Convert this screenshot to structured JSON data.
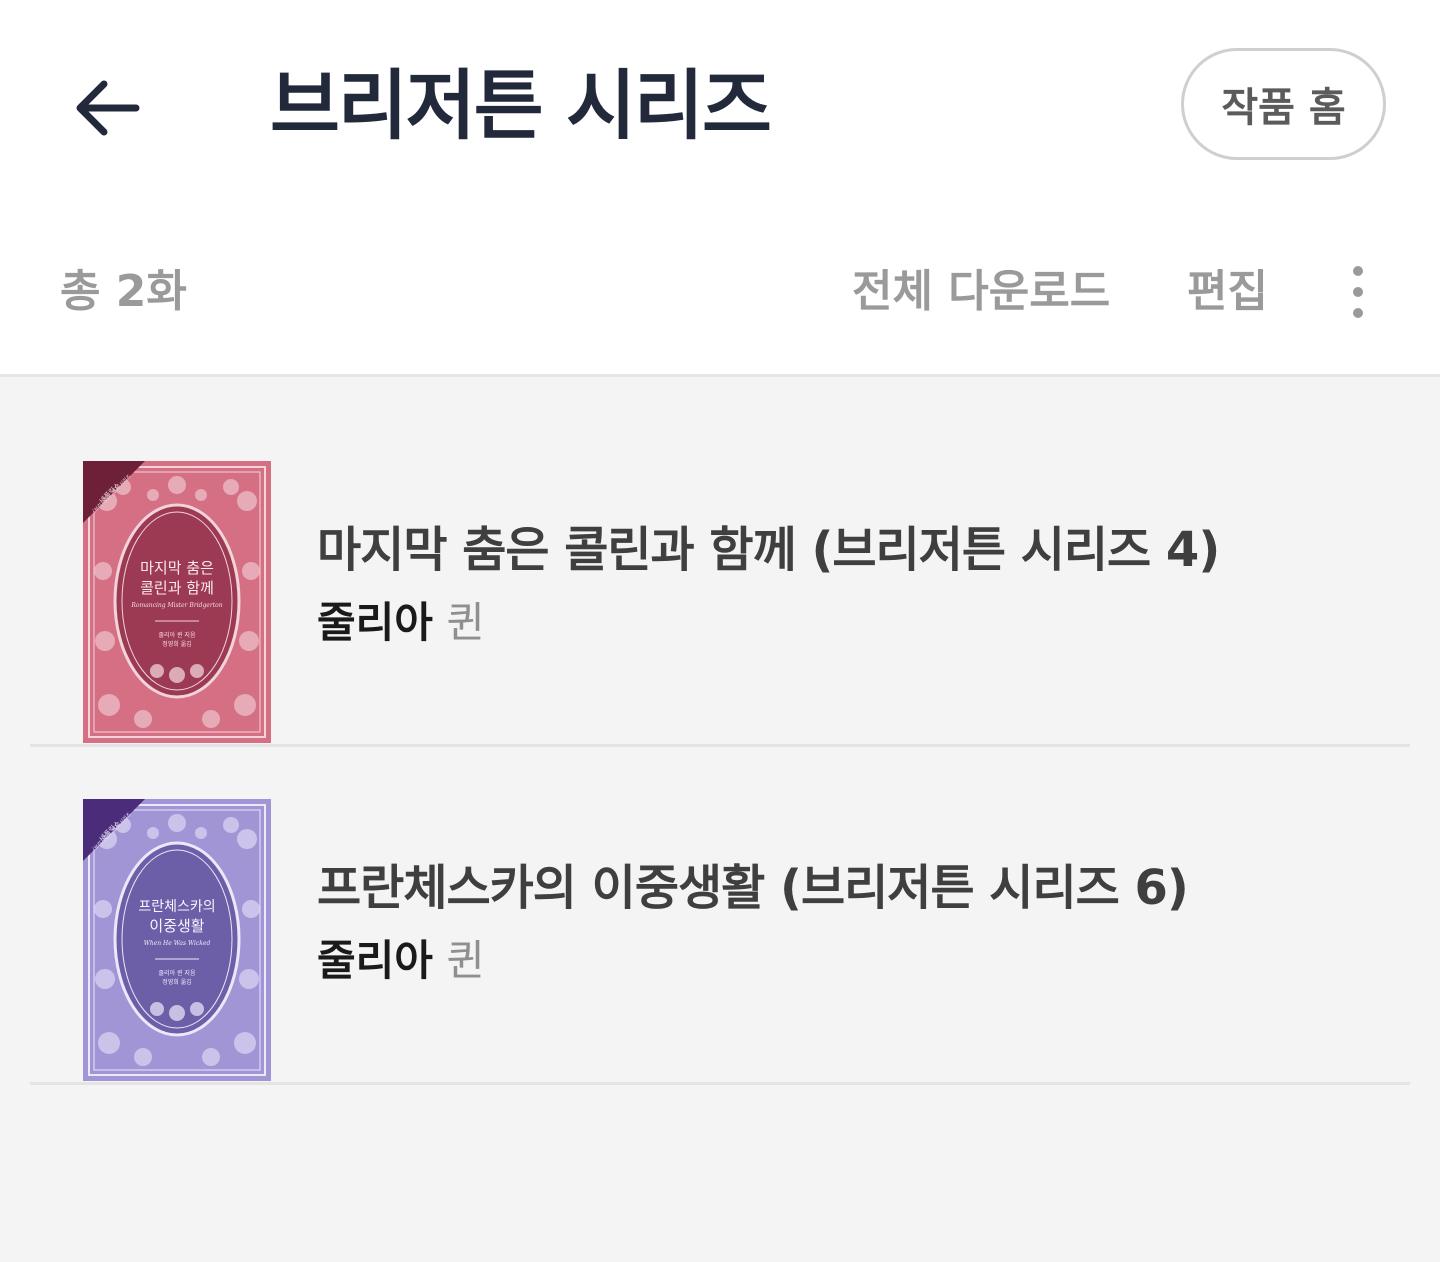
{
  "header": {
    "title": "브리저튼 시리즈",
    "home_button": "작품 홈"
  },
  "toolbar": {
    "count": "총 2화",
    "download_all": "전체 다운로드",
    "edit": "편집"
  },
  "books": [
    {
      "title": "마지막 춤은 콜린과 함께 (브리저튼 시리즈 4)",
      "author_first": "줄리아",
      "author_second": "퀸",
      "cover": {
        "ribbon_line1": "넷플릭스",
        "ribbon_line2": "〈브리저튼〉 원작 시리즈",
        "title_line1": "마지막 춤은",
        "title_line2": "콜린과 함께",
        "subtitle": "Romancing Mister Bridgerton",
        "credit_line1": "줄리아 퀸 지음",
        "credit_line2": "정영희 옮김",
        "base_color": "#d56f84",
        "dark_color": "#9c3a53",
        "ribbon_color": "#6e2038"
      }
    },
    {
      "title": "프란체스카의 이중생활 (브리저튼 시리즈 6)",
      "author_first": "줄리아",
      "author_second": "퀸",
      "cover": {
        "ribbon_line1": "넷플릭스",
        "ribbon_line2": "〈브리저튼〉 원작 시리즈",
        "title_line1": "프란체스카의",
        "title_line2": "이중생활",
        "subtitle": "When He Was Wicked",
        "credit_line1": "줄리아 퀸 지음",
        "credit_line2": "정영희 옮김",
        "base_color": "#a195d6",
        "dark_color": "#6c5fa8",
        "ribbon_color": "#4a2c7a"
      }
    }
  ]
}
